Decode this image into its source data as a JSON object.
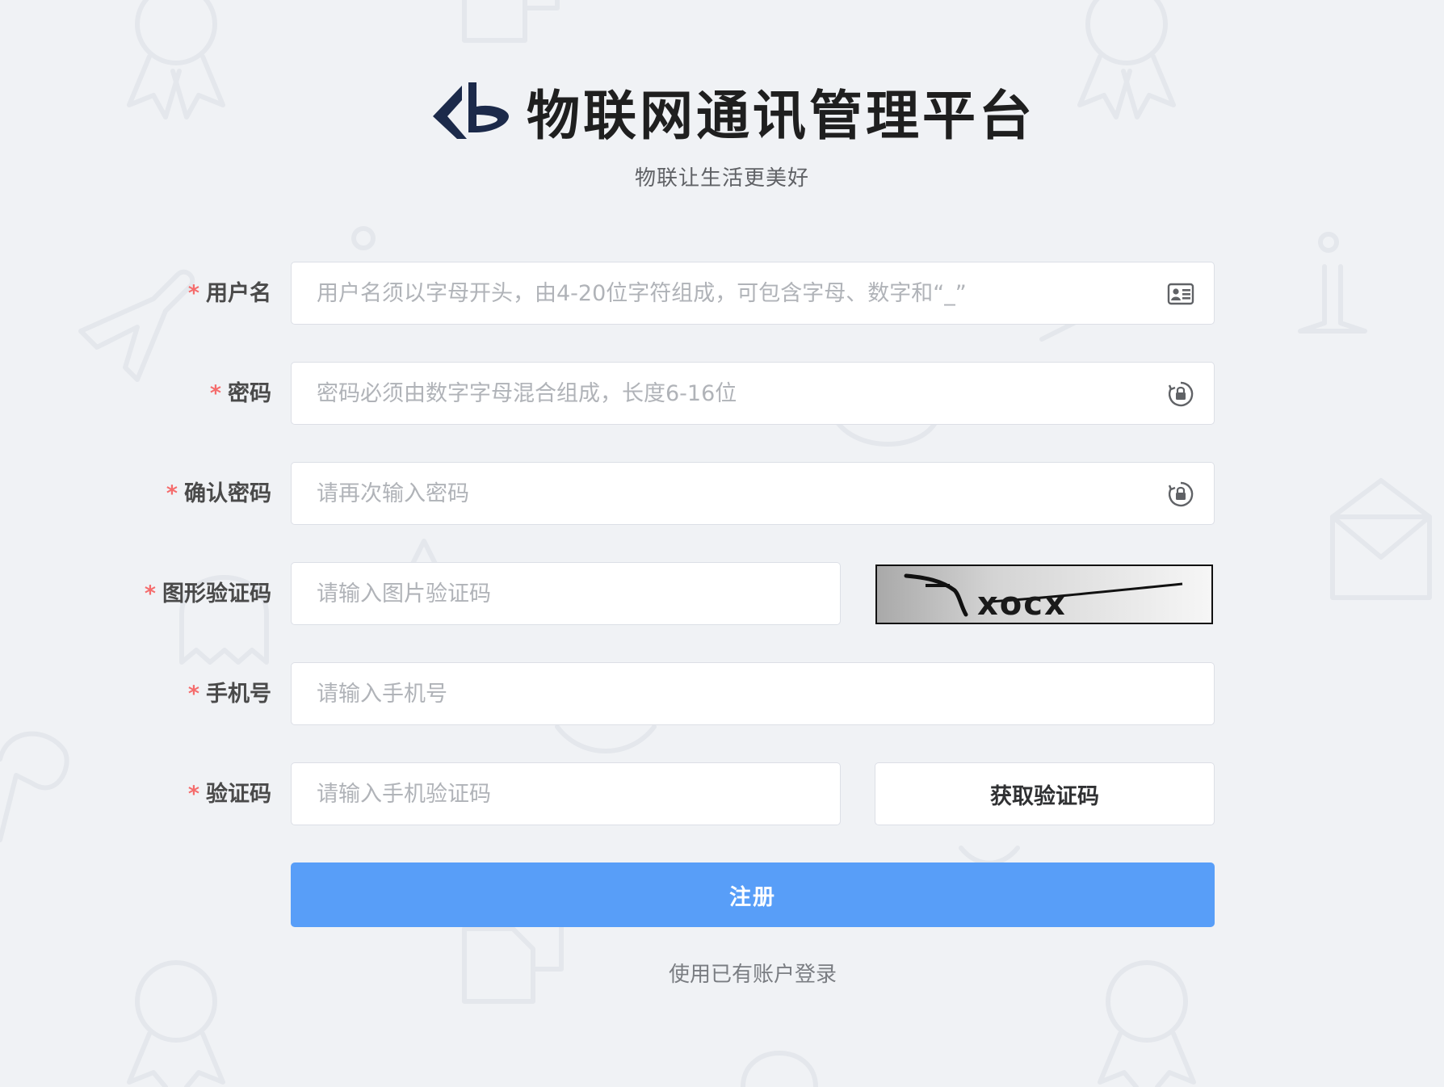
{
  "header": {
    "title": "物联网通讯管理平台",
    "slogan": "物联让生活更美好",
    "logo_color": "#1c2a4a"
  },
  "form": {
    "required_mark": "*",
    "username": {
      "label": "用户名",
      "placeholder": "用户名须以字母开头，由4-20位字符组成，可包含字母、数字和“_”",
      "icon": "id-card-icon"
    },
    "password": {
      "label": "密码",
      "placeholder": "密码必须由数字字母混合组成，长度6-16位",
      "icon": "lock-icon"
    },
    "confirm_password": {
      "label": "确认密码",
      "placeholder": "请再次输入密码",
      "icon": "lock-icon"
    },
    "image_captcha": {
      "label": "图形验证码",
      "placeholder": "请输入图片验证码",
      "captcha_text": "xocx"
    },
    "phone": {
      "label": "手机号",
      "placeholder": "请输入手机号"
    },
    "sms_code": {
      "label": "验证码",
      "placeholder": "请输入手机验证码",
      "button_label": "获取验证码"
    },
    "submit_label": "注册",
    "login_link": "使用已有账户登录"
  },
  "colors": {
    "background": "#f0f2f5",
    "primary_button": "#589ef8",
    "required": "#f56c6c",
    "label": "#4a4a4a"
  }
}
